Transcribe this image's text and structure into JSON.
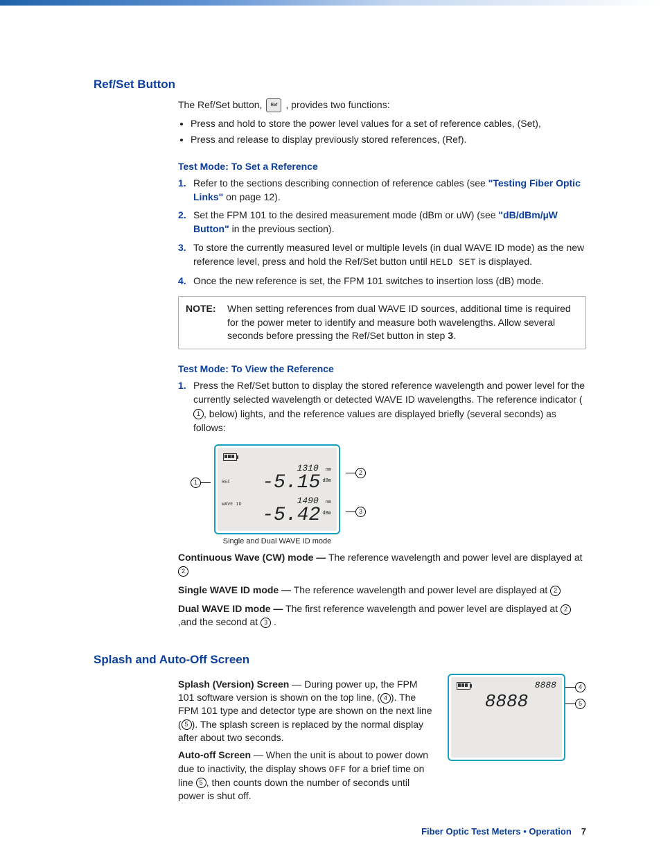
{
  "sections": {
    "refset": {
      "title": "Ref/Set Button",
      "intro_a": "The Ref/Set button,",
      "intro_b": ", provides two functions:",
      "key_label": "Ref",
      "bullets": [
        "Press and hold to store the power level values for a set of reference cables, (Set),",
        "Press and release to display previously stored references, (Ref)."
      ]
    },
    "to_set": {
      "title": "Test Mode: To Set a Reference",
      "items": [
        {
          "pre": "Refer to the sections describing connection of reference cables (see ",
          "link": "\"Testing Fiber Optic Links\"",
          "post": " on page 12)."
        },
        {
          "pre": "Set the FPM 101 to the desired measurement mode (dBm or uW) (see ",
          "link": "\"dB/dBm/µW Button\"",
          "post": " in the previous section)."
        },
        {
          "text": "To store the currently measured level or multiple levels (in dual WAVE ID mode) as the new reference level, press and hold the Ref/Set button until ",
          "code": "HELD SET",
          "post": " is displayed."
        },
        {
          "text": "Once the new reference is set, the FPM 101 switches to insertion loss (dB) mode."
        }
      ],
      "note_label": "NOTE:",
      "note_text_a": "When setting references from dual WAVE ID sources, additional time is required for the power meter to identify and measure both wavelengths. Allow several seconds before pressing the Ref/Set button in step ",
      "note_step": "3",
      "note_text_b": "."
    },
    "to_view": {
      "title": "Test Mode: To View the Reference",
      "item1_a": "Press the Ref/Set button to display the stored reference wavelength and power level for the currently selected wavelength or detected WAVE ID wavelengths. The reference indicator (",
      "item1_b": ", below) lights, and the reference values are displayed briefly (several seconds) as follows:"
    },
    "lcd1": {
      "ref_label": "REF",
      "waveid_label": "WAVE ID",
      "wave1": "1310",
      "wave2": "1490",
      "nm": "nm",
      "val1": "-5.15",
      "val2": "-5.42",
      "dbm": "dBm",
      "caption": "Single and Dual WAVE ID mode"
    },
    "modes": {
      "cw_b": "Continuous Wave (CW) mode —",
      "cw_t": " The reference wavelength and power level are displayed at ",
      "single_b": "Single WAVE ID mode —",
      "single_t": " The reference wavelength and power level are displayed at ",
      "dual_b": "Dual WAVE ID mode —",
      "dual_t_a": " The first reference wavelength and power level are displayed at ",
      "dual_t_b": ",and the second at ",
      "dual_t_c": " ."
    },
    "splash": {
      "title": "Splash and Auto-Off Screen",
      "sp_b": "Splash (Version) Screen",
      "sp_t_a": " — During power up, the FPM 101 software version is shown on the top line, (",
      "sp_t_b": "). The FPM 101 type and detector type are shown on the next line (",
      "sp_t_c": "). The splash screen is replaced by the normal display after about two seconds.",
      "ao_b": "Auto-off Screen",
      "ao_t_a": " — When the unit is about to power down due to inactivity, the display shows ",
      "ao_code": "OFF",
      "ao_t_b": " for a brief time on line ",
      "ao_t_c": ", then counts down the number of seconds until power is shut off.",
      "lcd_top": "8888",
      "lcd_big": "8888"
    }
  },
  "footer": {
    "label": "Fiber Optic Test Meters • Operation",
    "page": "7"
  }
}
